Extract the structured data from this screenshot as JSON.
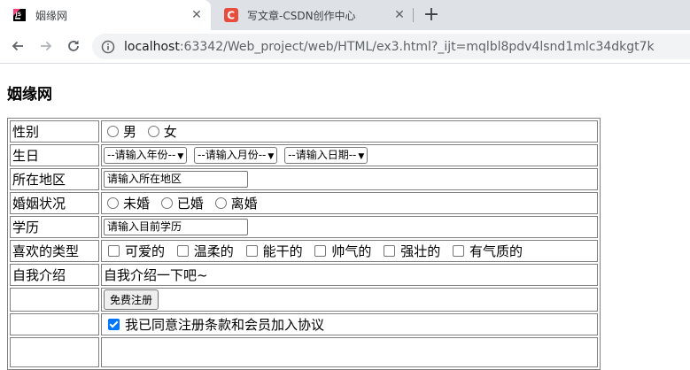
{
  "browser": {
    "tabs": [
      {
        "title": "姻缘网",
        "close": "✕"
      },
      {
        "title": "写文章-CSDN创作中心",
        "close": "✕"
      }
    ],
    "new_tab": "+",
    "url_host": "localhost",
    "url_rest": ":63342/Web_project/web/HTML/ex3.html?_ijt=mqlbl8pdv4lsnd1mlc34dkgt7k"
  },
  "page": {
    "title": "姻缘网",
    "rows": {
      "gender": {
        "label": "性别",
        "options": [
          "男",
          "女"
        ]
      },
      "birthday": {
        "label": "生日",
        "year": "--请输入年份--",
        "month": "--请输入月份--",
        "day": "--请输入日期--"
      },
      "region": {
        "label": "所在地区",
        "placeholder": "请输入所在地区"
      },
      "marital": {
        "label": "婚姻状况",
        "options": [
          "未婚",
          "已婚",
          "离婚"
        ]
      },
      "education": {
        "label": "学历",
        "placeholder": "请输入目前学历"
      },
      "types": {
        "label": "喜欢的类型",
        "options": [
          "可爱的",
          "温柔的",
          "能干的",
          "帅气的",
          "强壮的",
          "有气质的"
        ]
      },
      "intro": {
        "label": "自我介绍",
        "text": "自我介绍一下吧~"
      },
      "register": {
        "button": "免费注册"
      },
      "agree": {
        "text": "我已同意注册条款和会员加入协议",
        "checked": true
      }
    }
  },
  "colors": {
    "accent": "#0075ff",
    "tab_strip": "#dee1e6",
    "csdn": "#e74c3c"
  }
}
